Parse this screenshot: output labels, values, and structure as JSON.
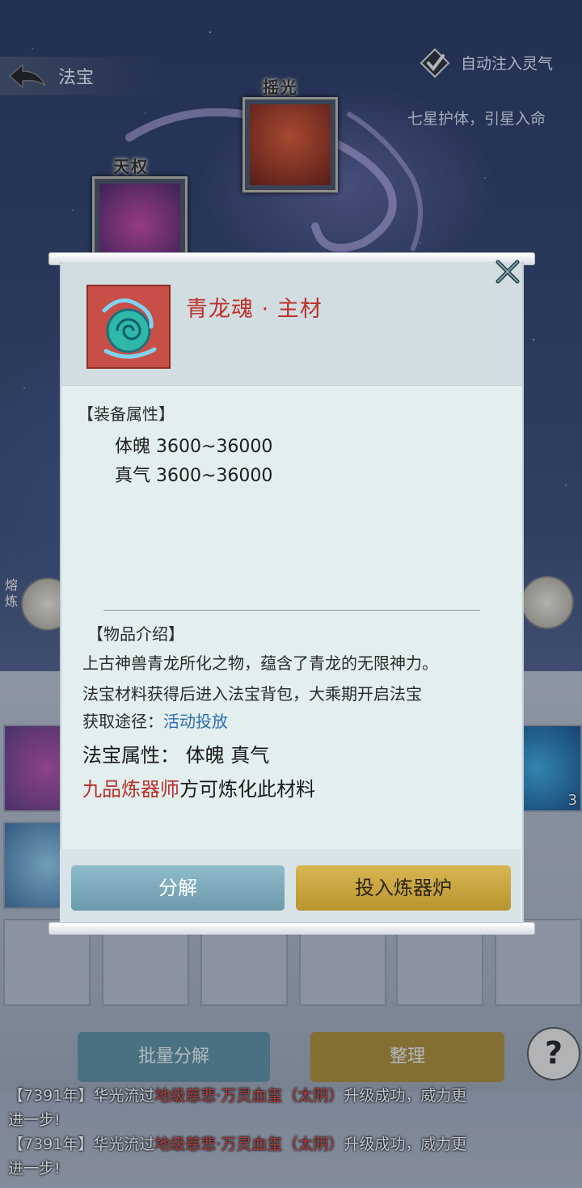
{
  "header": {
    "title": "法宝",
    "auto_inject_label": "自动注入灵气",
    "subtitle": "七星护体，引星入命"
  },
  "slots": [
    {
      "label": "摇光"
    },
    {
      "label": "天权"
    }
  ],
  "side": {
    "left_label": "熔炼",
    "inventory_count": "3"
  },
  "bottom": {
    "batch_decompose_label": "批量分解",
    "organize_label": "整理",
    "help_label": "?"
  },
  "chat": [
    {
      "prefix": "【7391年】华光流过",
      "highlight": "地级慈悲·万灵血玺（太阴）",
      "suffix": "升级成功，威力更",
      "line2": "进一步!"
    },
    {
      "prefix": "【7391年】华光流过",
      "highlight": "地级慈悲·万灵血玺（太阴）",
      "suffix": "升级成功，威力更",
      "line2": "进一步!"
    }
  ],
  "dialog": {
    "item_name": "青龙魂 · 主材",
    "attr_section": "【装备属性】",
    "attributes": [
      {
        "name": "体魄",
        "range": "3600~36000"
      },
      {
        "name": "真气",
        "range": "3600~36000"
      }
    ],
    "intro_section": "【物品介绍】",
    "intro_line1": "上古神兽青龙所化之物，蕴含了青龙的无限神力。",
    "intro_line2": "法宝材料获得后进入法宝背包，大乘期开启法宝",
    "source_prefix": "获取途径：",
    "source_link": "活动投放",
    "prop_label": "法宝属性：",
    "prop_values": "体魄 真气",
    "req_red": "九品炼器师",
    "req_rest": "方可炼化此材料",
    "decompose_label": "分解",
    "furnace_label": "投入炼器炉"
  },
  "colors": {
    "item_name": "#c0302a",
    "link": "#2a6fb1",
    "decompose_btn": "#7aa7b8",
    "furnace_btn": "#c9a640"
  }
}
